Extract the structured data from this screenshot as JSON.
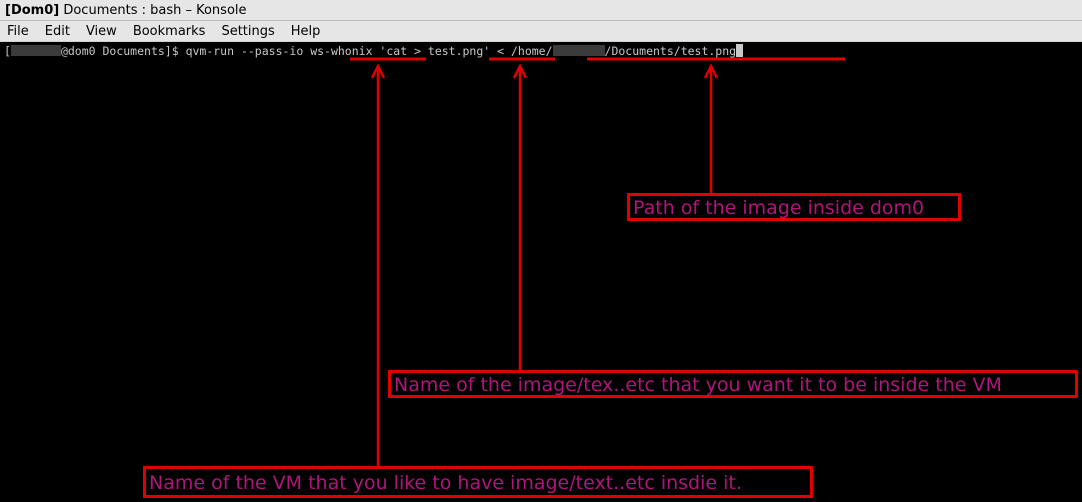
{
  "window": {
    "title_domain": "[Dom0]",
    "title": "Documents : bash – Konsole"
  },
  "menu": [
    "File",
    "Edit",
    "View",
    "Bookmarks",
    "Settings",
    "Help"
  ],
  "terminal": {
    "prompt_open": "[",
    "prompt_host": "@dom0 Documents]$ ",
    "command": "qvm-run --pass-io ",
    "vm_name": "ws-whonix",
    "cmd_mid": " 'cat > ",
    "target_file": "test.png",
    "cmd_quote": "' < ",
    "path_prefix": "/home/",
    "path_suffix": "/Documents/test.png"
  },
  "annotations": {
    "path_label": "Path of the image inside dom0",
    "name_label": "Name of the image/tex..etc that you want it to be inside the VM",
    "vm_label": "Name of the VM that you like to have image/text..etc insdie it."
  },
  "colors": {
    "annotation_red": "#e00000",
    "annotation_text": "#b0157a",
    "terminal_fg": "#c8c8c8",
    "terminal_bg": "#000000"
  }
}
